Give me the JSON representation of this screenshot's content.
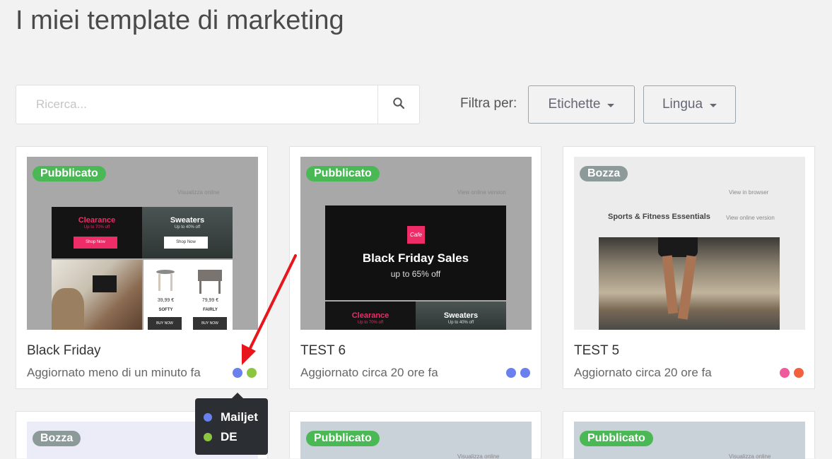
{
  "page": {
    "title": "I miei template di marketing"
  },
  "search": {
    "placeholder": "Ricerca...",
    "icon": "search-icon"
  },
  "filter": {
    "label": "Filtra per:",
    "tags_label": "Etichette",
    "language_label": "Lingua"
  },
  "colors": {
    "published": "#4bb856",
    "draft": "#8c9a99",
    "blue": "#6a80ee",
    "green": "#8cc63e",
    "pink": "#ee5a9a",
    "orange": "#f2603e",
    "tooltip_bg": "#2b2f33"
  },
  "cards": [
    {
      "name": "Black Friday",
      "updated": "Aggiornato meno di un minuto fa",
      "status": "Pubblicato",
      "preview": {
        "top_link": "Visualizza online",
        "clearance_title": "Clearance",
        "clearance_sub": "Up to 70% off",
        "shop_now": "Shop Now",
        "sweaters_title": "Sweaters",
        "sweaters_sub": "Up to 40% off",
        "shop_now_2": "Shop Now",
        "price1": "39,99 €",
        "name1": "SOFTY",
        "price2": "79,99 €",
        "name2": "FAIRLY",
        "buy1": "BUY NOW",
        "buy2": "BUY NOW"
      }
    },
    {
      "name": "TEST 6",
      "updated": "Aggiornato circa 20 ore fa",
      "status": "Pubblicato",
      "preview": {
        "top_link": "View online version",
        "logo": "Cafe",
        "headline": "Black Friday Sales",
        "sub": "up to 65% off",
        "clearance_title": "Clearance",
        "clearance_sub": "Up to 70% off",
        "sweaters_title": "Sweaters",
        "sweaters_sub": "Up to 40% off"
      }
    },
    {
      "name": "TEST 5",
      "updated": "Aggiornato circa 20 ore fa",
      "status": "Bozza",
      "preview": {
        "top_link": "View in browser",
        "title": "Sports & Fitness Essentials",
        "view_online": "View online version"
      }
    },
    {
      "status": "Bozza"
    },
    {
      "status": "Pubblicato",
      "preview": {
        "top_text": "Visualizza online"
      }
    },
    {
      "status": "Pubblicato",
      "preview": {
        "top_text": "Visualizza online"
      }
    }
  ],
  "tooltip": {
    "items": [
      {
        "label": "Mailjet",
        "color": "#6a80ee"
      },
      {
        "label": "DE",
        "color": "#8cc63e"
      }
    ]
  }
}
